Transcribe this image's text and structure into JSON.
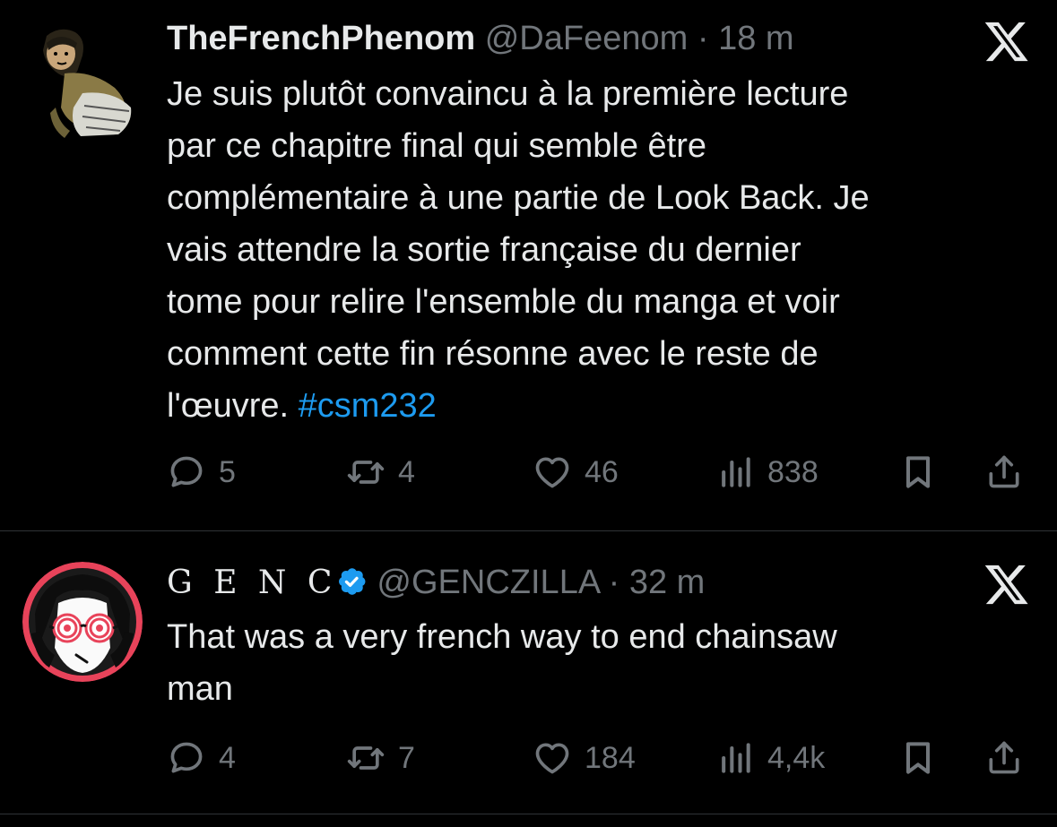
{
  "tweets": [
    {
      "name": "TheFrenchPhenom",
      "handle": "@DaFeenom",
      "separator": "·",
      "time": "18 m",
      "text_lines": [
        "Je suis plutôt convaincu à la première lecture",
        "par ce chapitre final qui semble être",
        "complémentaire à une partie de Look Back. Je",
        "vais attendre la sortie française du dernier",
        "tome pour relire l'ensemble du manga et voir",
        "comment cette fin résonne avec le reste de",
        "l'œuvre. "
      ],
      "hashtag": "#csm232",
      "verified": false,
      "replies": "5",
      "reposts": "4",
      "likes": "46",
      "views": "838"
    },
    {
      "name": "G E N C",
      "handle": "@GENCZILLA",
      "separator": "·",
      "time": "32 m",
      "text_lines": [
        "That was a very french way to end chainsaw",
        "man"
      ],
      "verified": true,
      "replies": "4",
      "reposts": "7",
      "likes": "184",
      "views": "4,4k"
    }
  ],
  "icons": {
    "reply": "speech-bubble-icon",
    "repost": "repost-arrows-icon",
    "like": "heart-icon",
    "views": "bar-chart-icon",
    "bookmark": "bookmark-icon",
    "share": "share-upload-icon",
    "brand": "x-logo-icon",
    "verified": "verified-badge-icon"
  },
  "colors": {
    "background": "#000000",
    "text": "#e7e9ea",
    "muted": "#71767b",
    "link": "#1d9bf0",
    "verified": "#1d9bf0",
    "divider": "#2f3336"
  }
}
